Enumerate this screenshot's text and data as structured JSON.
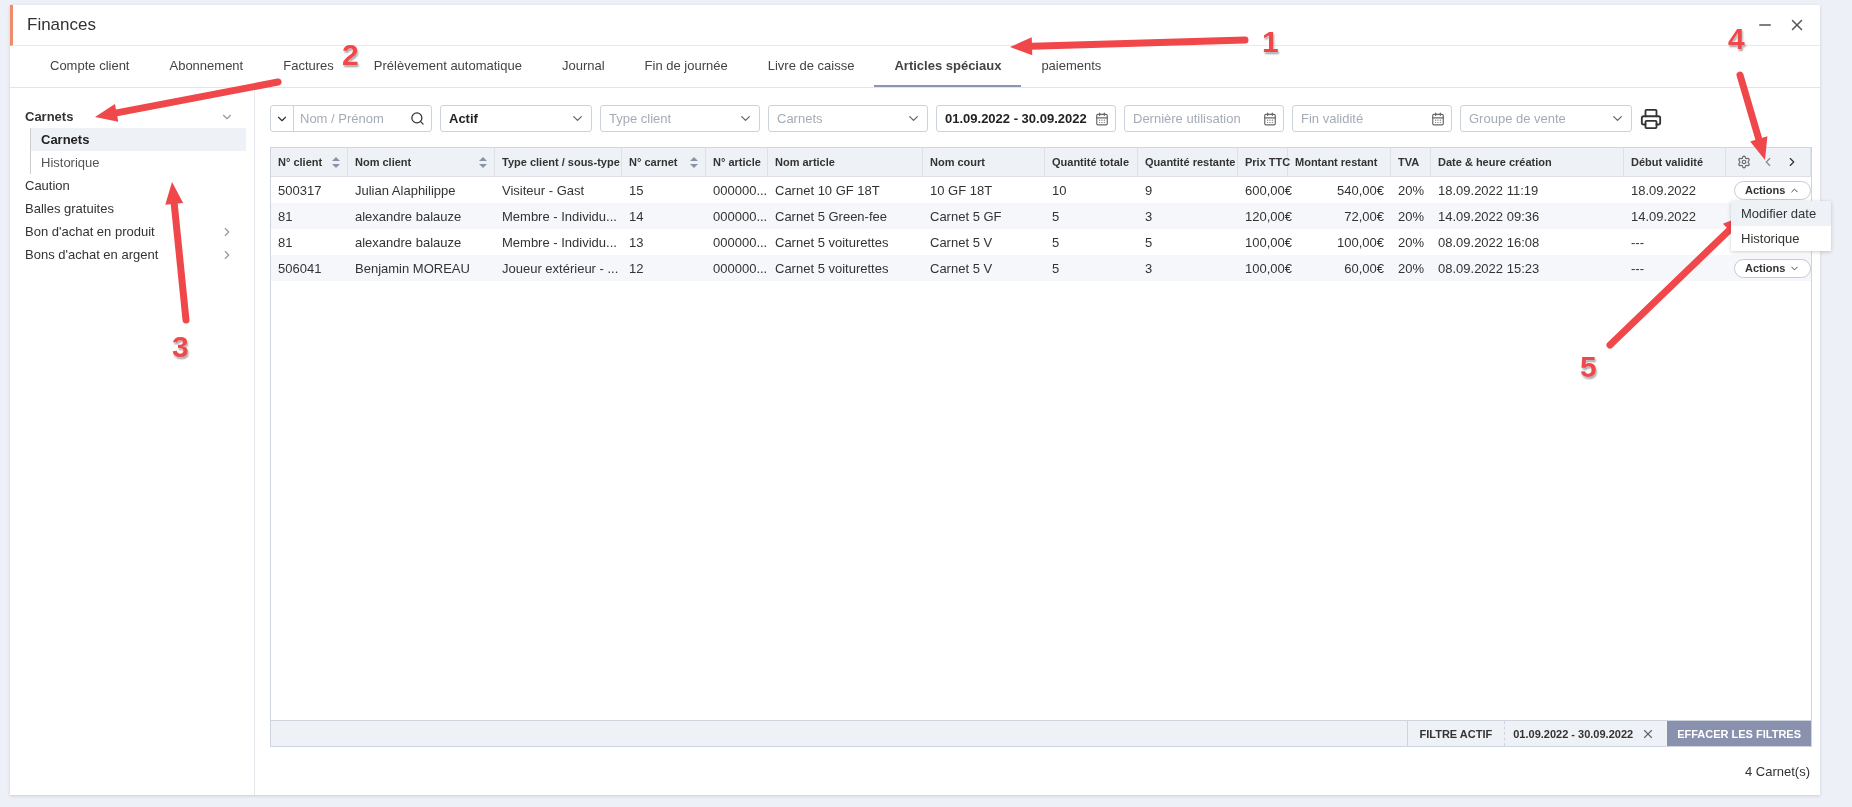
{
  "window": {
    "title": "Finances"
  },
  "tabs": [
    {
      "label": "Compte client",
      "selected": false
    },
    {
      "label": "Abonnement",
      "selected": false
    },
    {
      "label": "Factures",
      "selected": false
    },
    {
      "label": "Prélèvement automatique",
      "selected": false
    },
    {
      "label": "Journal",
      "selected": false
    },
    {
      "label": "Fin de journée",
      "selected": false
    },
    {
      "label": "Livre de caisse",
      "selected": false
    },
    {
      "label": "Articles spéciaux",
      "selected": true
    },
    {
      "label": "paiements",
      "selected": false
    }
  ],
  "sidebar": {
    "items": [
      {
        "label": "Carnets",
        "expanded": true,
        "children": [
          {
            "label": "Carnets",
            "selected": true
          },
          {
            "label": "Historique",
            "selected": false
          }
        ]
      },
      {
        "label": "Caution"
      },
      {
        "label": "Balles gratuites"
      },
      {
        "label": "Bon d'achat en produit",
        "expanded": false
      },
      {
        "label": "Bons d'achat en argent",
        "expanded": false
      }
    ]
  },
  "filters": [
    {
      "kind": "search",
      "placeholder": "Nom / Prénom"
    },
    {
      "kind": "select",
      "value": "Actif"
    },
    {
      "kind": "select",
      "placeholder": "Type client"
    },
    {
      "kind": "select",
      "placeholder": "Carnets"
    },
    {
      "kind": "date",
      "value": "01.09.2022 - 30.09.2022"
    },
    {
      "kind": "date",
      "placeholder": "Dernière utilisation"
    },
    {
      "kind": "date",
      "placeholder": "Fin validité"
    },
    {
      "kind": "select",
      "placeholder": "Groupe de vente"
    }
  ],
  "table": {
    "columns": [
      {
        "label": "N° client",
        "sortable": true
      },
      {
        "label": "Nom client",
        "sortable": true
      },
      {
        "label": "Type client / sous-type",
        "sortable": false
      },
      {
        "label": "N° carnet",
        "sortable": true
      },
      {
        "label": "N° article",
        "sortable": false
      },
      {
        "label": "Nom article",
        "sortable": false
      },
      {
        "label": "Nom court",
        "sortable": false
      },
      {
        "label": "Quantité totale",
        "sortable": false
      },
      {
        "label": "Quantité restante",
        "sortable": false
      },
      {
        "label": "Prix TTC",
        "sortable": false
      },
      {
        "label": "Montant restant",
        "sortable": false
      },
      {
        "label": "TVA",
        "sortable": false
      },
      {
        "label": "Date & heure création",
        "sortable": false
      },
      {
        "label": "Début validité",
        "sortable": false
      }
    ],
    "rows": [
      {
        "cells": [
          "500317",
          "Julian Alaphilippe",
          "Visiteur - Gast",
          "15",
          "000000...",
          "Carnet 10 GF 18T",
          "10 GF 18T",
          "10",
          "9",
          "600,00€",
          "540,00€",
          "20%",
          "18.09.2022 11:19",
          "18.09.2022"
        ],
        "actions": {
          "label": "Actions",
          "expanded": true
        }
      },
      {
        "cells": [
          "81",
          "alexandre balauze",
          "Membre - Individu...",
          "14",
          "000000...",
          "Carnet 5 Green-fee",
          "Carnet 5 GF",
          "5",
          "3",
          "120,00€",
          "72,00€",
          "20%",
          "14.09.2022 09:36",
          "14.09.2022"
        ]
      },
      {
        "cells": [
          "81",
          "alexandre balauze",
          "Membre - Individu...",
          "13",
          "000000...",
          "Carnet 5 voiturettes",
          "Carnet 5 V",
          "5",
          "5",
          "100,00€",
          "100,00€",
          "20%",
          "08.09.2022 16:08",
          "---"
        ]
      },
      {
        "cells": [
          "506041",
          "Benjamin MOREAU",
          "Joueur extérieur - ...",
          "12",
          "000000...",
          "Carnet 5 voiturettes",
          "Carnet 5 V",
          "5",
          "3",
          "100,00€",
          "60,00€",
          "20%",
          "08.09.2022 15:23",
          "---"
        ],
        "actions": {
          "label": "Actions",
          "expanded": false
        }
      }
    ],
    "menu": [
      {
        "label": "Modifier date",
        "selected": true
      },
      {
        "label": "Historique",
        "selected": false
      }
    ]
  },
  "filter_bar": {
    "label": "FILTRE ACTIF",
    "chip": "01.09.2022 - 30.09.2022",
    "button": "EFFACER LES FILTRES"
  },
  "count": "4 Carnet(s)",
  "annotations": [
    {
      "label": "1"
    },
    {
      "label": "2"
    },
    {
      "label": "3"
    },
    {
      "label": "4"
    },
    {
      "label": "5"
    }
  ]
}
